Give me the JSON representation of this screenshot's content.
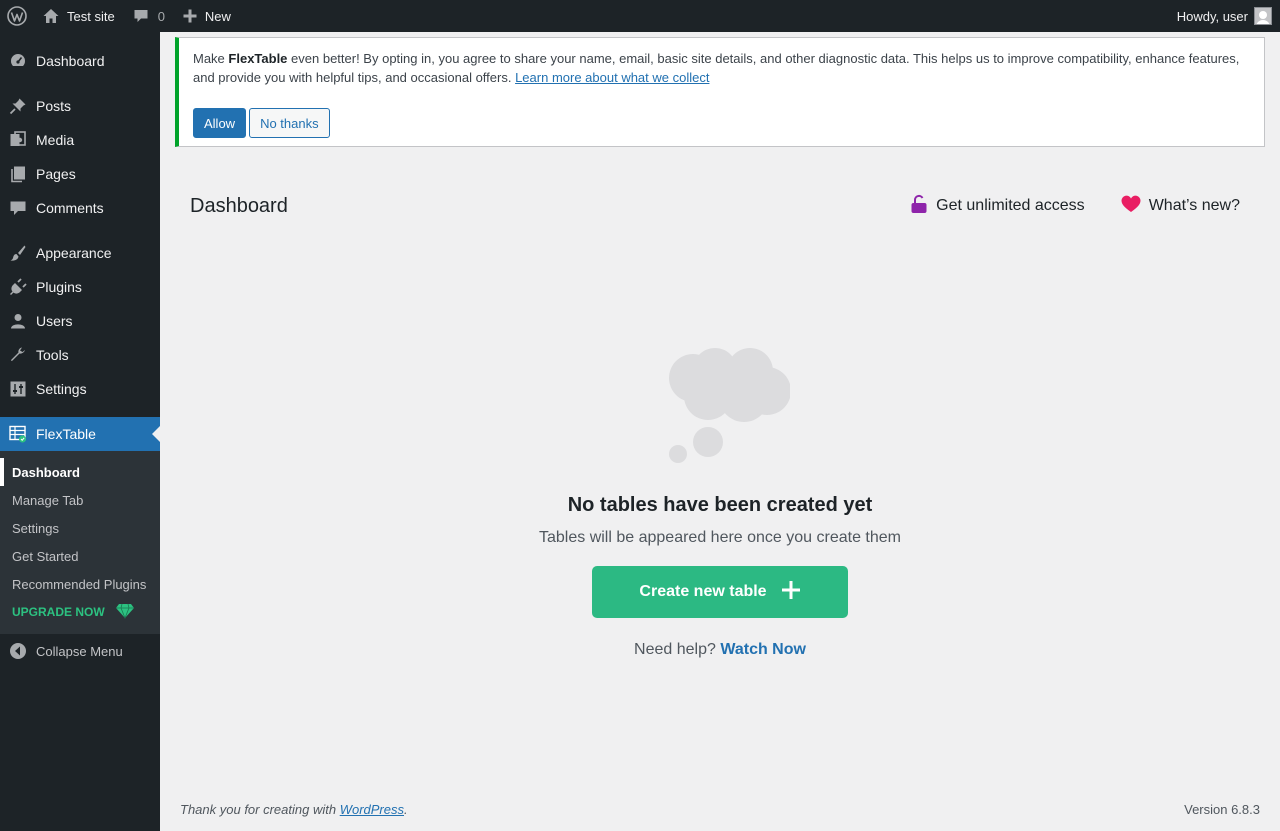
{
  "adminbar": {
    "site_name": "Test site",
    "comments_count": "0",
    "new_label": "New",
    "greeting": "Howdy, user"
  },
  "sidebar": {
    "items": [
      {
        "label": "Dashboard",
        "icon": "dashboard-icon"
      },
      {
        "label": "Posts",
        "icon": "pushpin-icon"
      },
      {
        "label": "Media",
        "icon": "media-icon"
      },
      {
        "label": "Pages",
        "icon": "pages-icon"
      },
      {
        "label": "Comments",
        "icon": "comment-icon"
      },
      {
        "label": "Appearance",
        "icon": "paintbrush-icon"
      },
      {
        "label": "Plugins",
        "icon": "plug-icon"
      },
      {
        "label": "Users",
        "icon": "user-icon"
      },
      {
        "label": "Tools",
        "icon": "wrench-icon"
      },
      {
        "label": "Settings",
        "icon": "settings-icon"
      },
      {
        "label": "FlexTable",
        "icon": "table-icon"
      }
    ],
    "submenu": [
      "Dashboard",
      "Manage Tab",
      "Settings",
      "Get Started",
      "Recommended Plugins",
      "UPGRADE NOW"
    ],
    "collapse_label": "Collapse Menu"
  },
  "notice": {
    "text_before": "Make ",
    "brand": "FlexTable",
    "text_after": " even better! By opting in, you agree to share your name, email, basic site details, and other diagnostic data. This helps us to improve compatibility, enhance features, and provide you with helpful tips, and occasional offers. ",
    "link_text": "Learn more about what we collect",
    "allow_label": "Allow",
    "no_thanks_label": "No thanks"
  },
  "header": {
    "title": "Dashboard",
    "unlimited_label": "Get unlimited access",
    "whats_new_label": "What’s new?"
  },
  "empty_state": {
    "title": "No tables have been created yet",
    "subtitle": "Tables will be appeared here once you create them",
    "create_label": "Create new table",
    "help_text": "Need help?",
    "help_link": "Watch Now"
  },
  "footer": {
    "thanks_text": "Thank you for creating with ",
    "wp_link": "WordPress",
    "period": ".",
    "version": "Version 6.8.3"
  },
  "colors": {
    "admin_dark": "#1d2327",
    "accent_blue": "#2271b1",
    "notice_green": "#00a32a",
    "create_green": "#2cb983",
    "upgrade_green": "#2cc281",
    "lock_purple": "#8e24aa",
    "heart_pink": "#e91e63"
  }
}
